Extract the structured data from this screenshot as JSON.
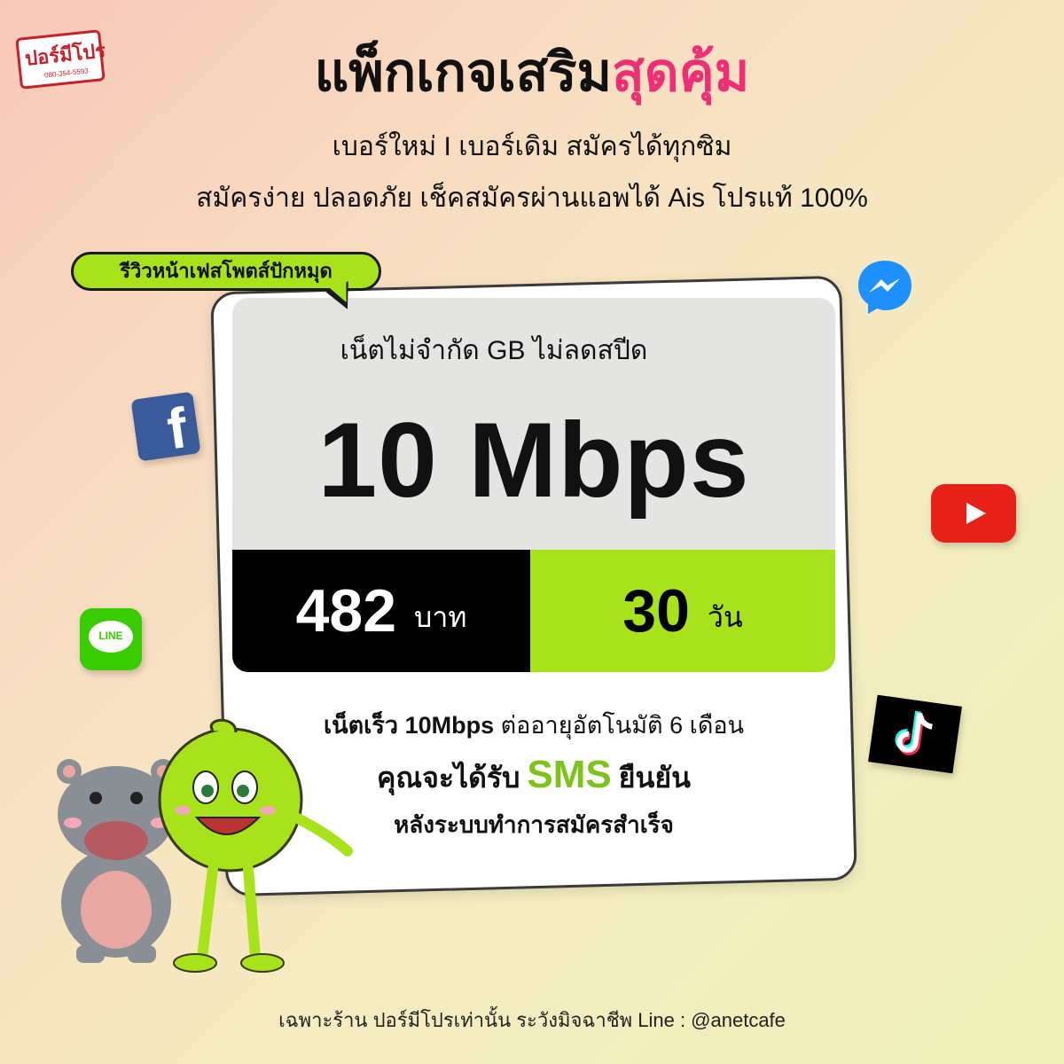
{
  "logo": {
    "text": "ปอร์มีโปร",
    "phone": "080-354-5593"
  },
  "header": {
    "title_main": "แพ็กเกจเสริม",
    "title_accent": "สุดคุ้ม",
    "subtitle_1": "เบอร์ใหม่ I เบอร์เดิม สมัครได้ทุกซิม",
    "subtitle_2": "สมัครง่าย ปลอดภัย เช็คสมัครผ่านแอพได้  Ais โปรแท้ 100%"
  },
  "review_badge": "รีวิวหน้าเฟสโพตส์ปักหมุด",
  "package": {
    "net_text": "เน็ตไม่จำกัด GB ไม่ลดสปีด",
    "speed": "10 Mbps",
    "price": "482",
    "price_unit": "บาท",
    "days": "30",
    "days_unit": "วัน"
  },
  "details": {
    "line1_bold": "เน็ตเร็ว 10Mbps",
    "line1_rest": " ต่ออายุอัตโนมัติ 6 เดือน",
    "line2_pre": "คุณจะได้รับ",
    "line2_sms": "SMS",
    "line2_post": "ยืนยัน",
    "line3": "หลังระบบทำการสมัครสำเร็จ"
  },
  "social_icons": [
    "facebook-icon",
    "messenger-icon",
    "youtube-icon",
    "line-icon",
    "tiktok-icon"
  ],
  "line_icon_label": "LINE",
  "footer": "เฉพาะร้าน ปอร์มีโปรเท่านั้น ระวังมิจฉาชีพ Line : @anetcafe",
  "colors": {
    "accent_pink": "#ee2e75",
    "accent_green": "#a8e21a",
    "sms_green": "#7ec31b",
    "price_bg": "#000000"
  }
}
